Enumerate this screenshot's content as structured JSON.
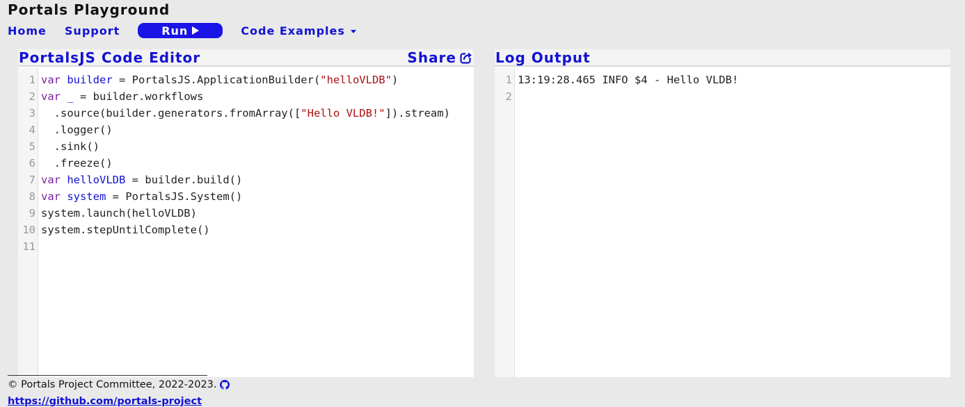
{
  "app": {
    "title": "Portals Playground"
  },
  "nav": {
    "home": "Home",
    "support": "Support",
    "run": "Run",
    "examples": "Code Examples"
  },
  "editor": {
    "title": "PortalsJS Code Editor",
    "share": "Share",
    "lines": [
      [
        {
          "t": "var",
          "c": "kw"
        },
        {
          "t": " "
        },
        {
          "t": "builder",
          "c": "def"
        },
        {
          "t": " = PortalsJS.ApplicationBuilder("
        },
        {
          "t": "\"helloVLDB\"",
          "c": "str"
        },
        {
          "t": ")"
        }
      ],
      [
        {
          "t": "var",
          "c": "kw"
        },
        {
          "t": " "
        },
        {
          "t": "_",
          "c": "def"
        },
        {
          "t": " = builder.workflows"
        }
      ],
      [
        {
          "t": "  .source(builder.generators.fromArray(["
        },
        {
          "t": "\"Hello VLDB!\"",
          "c": "str"
        },
        {
          "t": "]).stream)"
        }
      ],
      [
        {
          "t": "  .logger()"
        }
      ],
      [
        {
          "t": "  .sink()"
        }
      ],
      [
        {
          "t": "  .freeze()"
        }
      ],
      [
        {
          "t": "var",
          "c": "kw"
        },
        {
          "t": " "
        },
        {
          "t": "helloVLDB",
          "c": "def"
        },
        {
          "t": " = builder.build()"
        }
      ],
      [
        {
          "t": "var",
          "c": "kw"
        },
        {
          "t": " "
        },
        {
          "t": "system",
          "c": "def"
        },
        {
          "t": " = PortalsJS.System()"
        }
      ],
      [
        {
          "t": "system.launch(helloVLDB)"
        }
      ],
      [
        {
          "t": "system.stepUntilComplete()"
        }
      ],
      []
    ]
  },
  "log": {
    "title": "Log Output",
    "lines": [
      "13:19:28.465 INFO $4 - Hello VLDB!",
      ""
    ]
  },
  "footer": {
    "copyright": "© Portals Project Committee, 2022-2023.",
    "link": "https://github.com/portals-project"
  },
  "colors": {
    "accent": "#1a14e6",
    "keyword": "#7a1fa2",
    "string": "#aa1111"
  }
}
